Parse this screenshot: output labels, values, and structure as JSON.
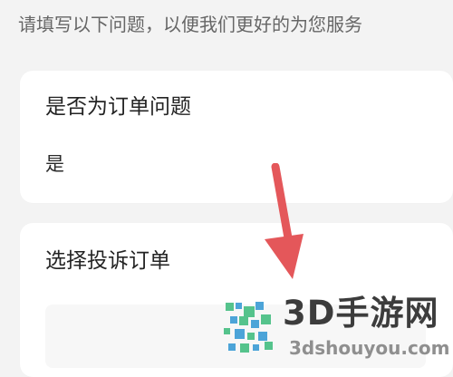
{
  "intro": {
    "text": "请填写以下问题，以便我们更好的为您服务"
  },
  "question": {
    "label": "是否为订单问题",
    "answer": "是"
  },
  "order": {
    "label": "选择投诉订单"
  },
  "watermark": {
    "title": "3D手游网",
    "site": "3dshouyou.com"
  },
  "colors": {
    "background": "#f3f3f3",
    "card": "#ffffff",
    "arrow": "#e4575a",
    "watermark_green": "#55c38c",
    "watermark_blue": "#4ca4d8",
    "watermark_text": "#3c3c3c"
  },
  "icons": {
    "annotation": "arrow-down-icon",
    "logo": "3d-shouyou-logo-icon"
  }
}
